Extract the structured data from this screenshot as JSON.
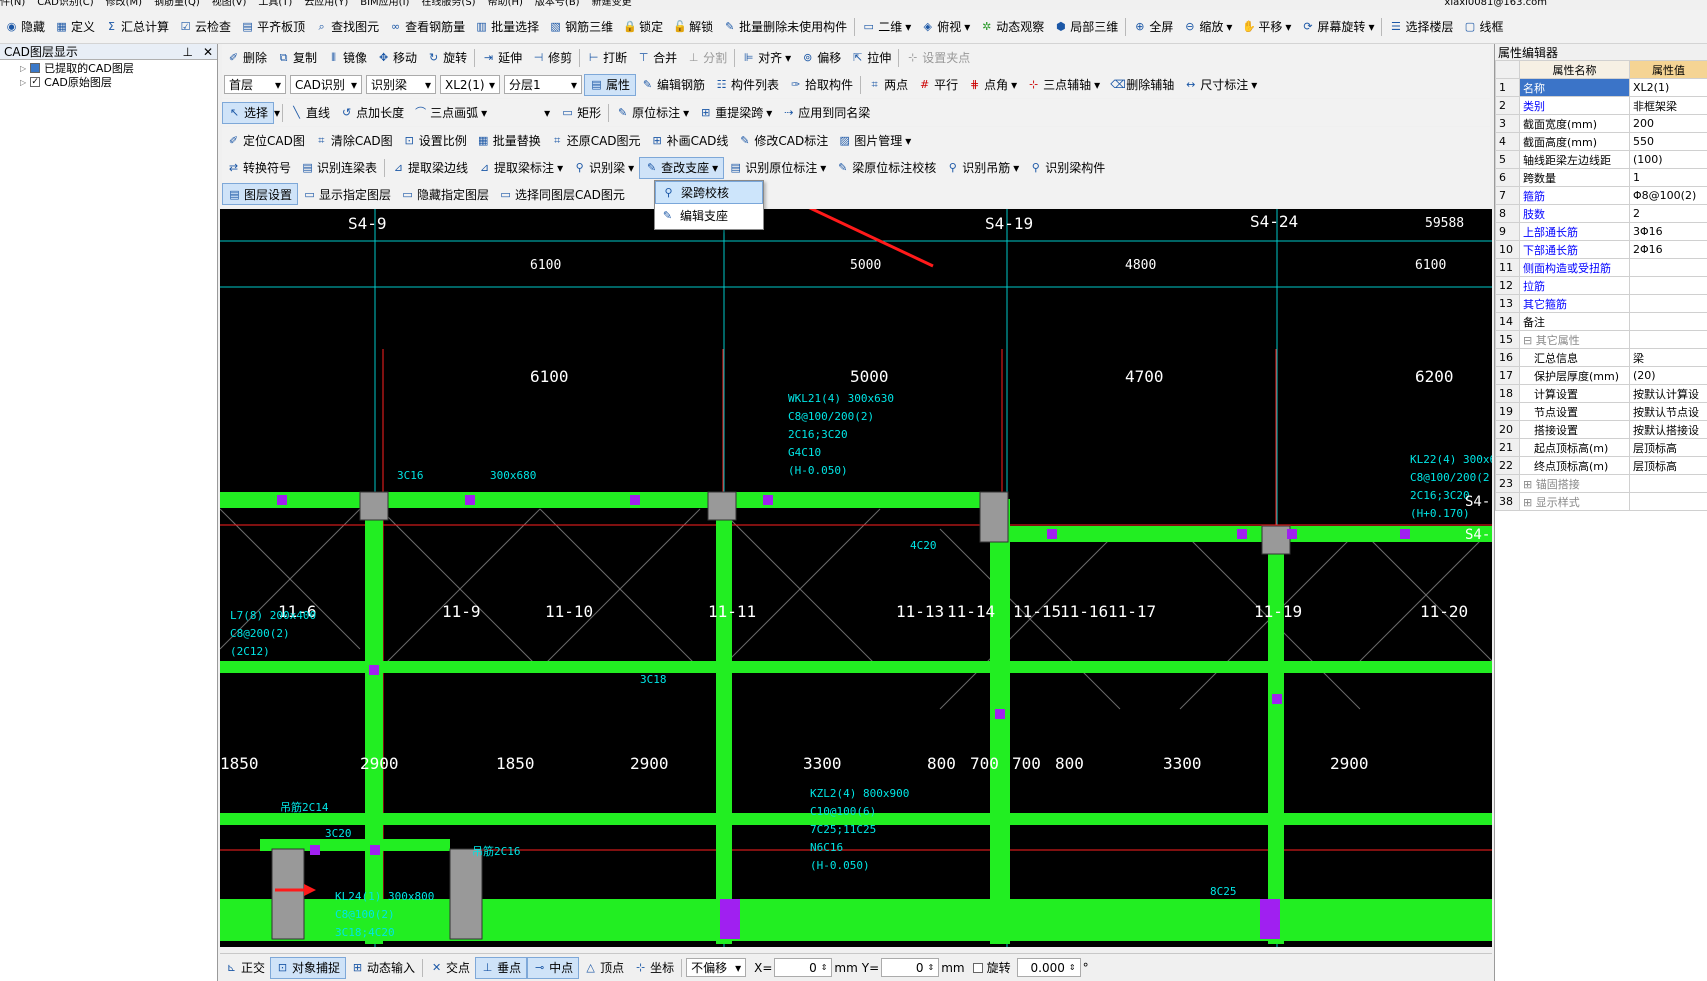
{
  "menubar": {
    "items": [
      "件(N)",
      "CAD识别(C)",
      "修改(M)",
      "钢筋量(Q)",
      "视图(V)",
      "工具(T)",
      "云应用(Y)",
      "BIM应用(I)",
      "在线服务(S)",
      "帮助(H)",
      "版本号(B)",
      "新建变更",
      "xiaxi0081@163.com"
    ]
  },
  "toolbar1": {
    "items": [
      "隐藏",
      "定义",
      "汇总计算",
      "云检查",
      "平齐板顶",
      "查找图元",
      "查看钢筋量",
      "批量选择",
      "钢筋三维",
      "锁定",
      "解锁",
      "批量删除未使用构件",
      "二维",
      "俯视",
      "动态观察",
      "局部三维",
      "全屏",
      "缩放",
      "平移",
      "屏幕旋转",
      "选择楼层",
      "线框"
    ]
  },
  "cad_panel": {
    "title": "CAD图层显示",
    "pin": "⊥",
    "close": "✕",
    "tree": [
      "已提取的CAD图层",
      "CAD原始图层"
    ]
  },
  "toolbar2": {
    "items": [
      "删除",
      "复制",
      "镜像",
      "移动",
      "旋转",
      "延伸",
      "修剪",
      "打断",
      "合并",
      "分割",
      "对齐",
      "偏移",
      "拉伸",
      "设置夹点"
    ]
  },
  "toolbar3": {
    "floor": "首层",
    "cad": "CAD识别",
    "type": "识别梁",
    "comp": "XL2(1)",
    "layer": "分层1",
    "items": [
      "属性",
      "编辑钢筋",
      "构件列表",
      "拾取构件",
      "两点",
      "平行",
      "点角",
      "三点辅轴",
      "删除辅轴",
      "尺寸标注"
    ]
  },
  "toolbar4": {
    "items": [
      "选择",
      "直线",
      "点加长度",
      "三点画弧",
      "矩形",
      "原位标注",
      "重提梁跨",
      "应用到同名梁"
    ]
  },
  "toolbar5": {
    "items": [
      "定位CAD图",
      "清除CAD图",
      "设置比例",
      "批量替换",
      "还原CAD图元",
      "补画CAD线",
      "修改CAD标注",
      "图片管理"
    ]
  },
  "toolbar6": {
    "items": [
      "转换符号",
      "识别连梁表",
      "提取梁边线",
      "提取梁标注",
      "识别梁",
      "查改支座",
      "识别原位标注",
      "梁原位标注校核",
      "识别吊筋",
      "识别梁构件"
    ]
  },
  "toolbar7": {
    "items": [
      "图层设置",
      "显示指定图层",
      "隐藏指定图层",
      "选择同图层CAD图元",
      "元"
    ]
  },
  "dropdown": {
    "items": [
      "梁跨校核",
      "编辑支座"
    ]
  },
  "properties": {
    "title": "属性编辑器",
    "header": [
      "属性名称",
      "属性值"
    ],
    "rows": [
      {
        "n": "1",
        "name": "名称",
        "value": "XL2(1)",
        "style": "blue",
        "sel": true
      },
      {
        "n": "2",
        "name": "类别",
        "value": "非框架梁",
        "style": "blue"
      },
      {
        "n": "3",
        "name": "截面宽度(mm)",
        "value": "200",
        "style": ""
      },
      {
        "n": "4",
        "name": "截面高度(mm)",
        "value": "550",
        "style": ""
      },
      {
        "n": "5",
        "name": "轴线距梁左边线距",
        "value": "(100)",
        "style": ""
      },
      {
        "n": "6",
        "name": "跨数量",
        "value": "1",
        "style": ""
      },
      {
        "n": "7",
        "name": "箍筋",
        "value": "Φ8@100(2)",
        "style": "blue"
      },
      {
        "n": "8",
        "name": "肢数",
        "value": "2",
        "style": "blue"
      },
      {
        "n": "9",
        "name": "上部通长筋",
        "value": "3Φ16",
        "style": "blue"
      },
      {
        "n": "10",
        "name": "下部通长筋",
        "value": "2Φ16",
        "style": "blue"
      },
      {
        "n": "11",
        "name": "侧面构造或受扭筋",
        "value": "",
        "style": "blue"
      },
      {
        "n": "12",
        "name": "拉筋",
        "value": "",
        "style": "blue"
      },
      {
        "n": "13",
        "name": "其它箍筋",
        "value": "",
        "style": "blue"
      },
      {
        "n": "14",
        "name": "备注",
        "value": "",
        "style": ""
      },
      {
        "n": "15",
        "name": "⊟ 其它属性",
        "value": "",
        "style": "grey"
      },
      {
        "n": "16",
        "name": "　汇总信息",
        "value": "梁",
        "style": ""
      },
      {
        "n": "17",
        "name": "　保护层厚度(mm)",
        "value": "(20)",
        "style": ""
      },
      {
        "n": "18",
        "name": "　计算设置",
        "value": "按默认计算设",
        "style": ""
      },
      {
        "n": "19",
        "name": "　节点设置",
        "value": "按默认节点设",
        "style": ""
      },
      {
        "n": "20",
        "name": "　搭接设置",
        "value": "按默认搭接设",
        "style": ""
      },
      {
        "n": "21",
        "name": "　起点顶标高(m)",
        "value": "层顶标高",
        "style": ""
      },
      {
        "n": "22",
        "name": "　终点顶标高(m)",
        "value": "层顶标高",
        "style": ""
      },
      {
        "n": "23",
        "name": "⊞ 锚固搭接",
        "value": "",
        "style": "grey"
      },
      {
        "n": "38",
        "name": "⊞ 显示样式",
        "value": "",
        "style": "grey"
      }
    ]
  },
  "statusbar": {
    "items": [
      "正交",
      "对象捕捉",
      "动态输入",
      "交点",
      "垂点",
      "中点",
      "顶点",
      "坐标"
    ],
    "offset": "不偏移",
    "x_label": "X=",
    "x_val": "0",
    "y_label": "Y=",
    "y_val": "0",
    "unit": "mm",
    "rotate": "旋转",
    "rot_val": "0.000",
    "deg": "°"
  },
  "canvas": {
    "axis_top": [
      "S4-9",
      "S4-19",
      "S4-24",
      "59588"
    ],
    "dims_top": [
      "6100",
      "5000",
      "4800",
      "6100"
    ],
    "dims_mid": [
      "6100",
      "5000",
      "4700",
      "6200"
    ],
    "axis_mid": [
      "11-6",
      "11-9",
      "11-10",
      "11-11",
      "11-13",
      "11-14",
      "11-15",
      "11-16",
      "11-17",
      "11-19",
      "11-20"
    ],
    "dims_low": [
      "1850",
      "2900",
      "1850",
      "2900",
      "3300",
      "800",
      "700",
      "700",
      "800",
      "3300",
      "2900"
    ],
    "labels": [
      "WKL21(4) 300x630",
      "C8@100/200(2)",
      "2C16;3C20",
      "G4C10",
      "(H-0.050)",
      "KL22(4) 300x60",
      "C8@100/200(2",
      "2C16;3C20",
      "(H+0.170)",
      "KZL2(4) 800x900",
      "C10@100(6)",
      "7C25;11C25",
      "N6C16",
      "(H-0.050)",
      "KL24(1) 300x800",
      "C8@100(2)",
      "3C18;4C20",
      "L7(8) 200x400",
      "C8@200(2)",
      "(2C12)",
      "吊筋2C14",
      "吊筋2C16",
      "3C16",
      "3C18",
      "3C20",
      "4C20",
      "300x680",
      "8C25",
      "S4-",
      "S4-"
    ]
  }
}
